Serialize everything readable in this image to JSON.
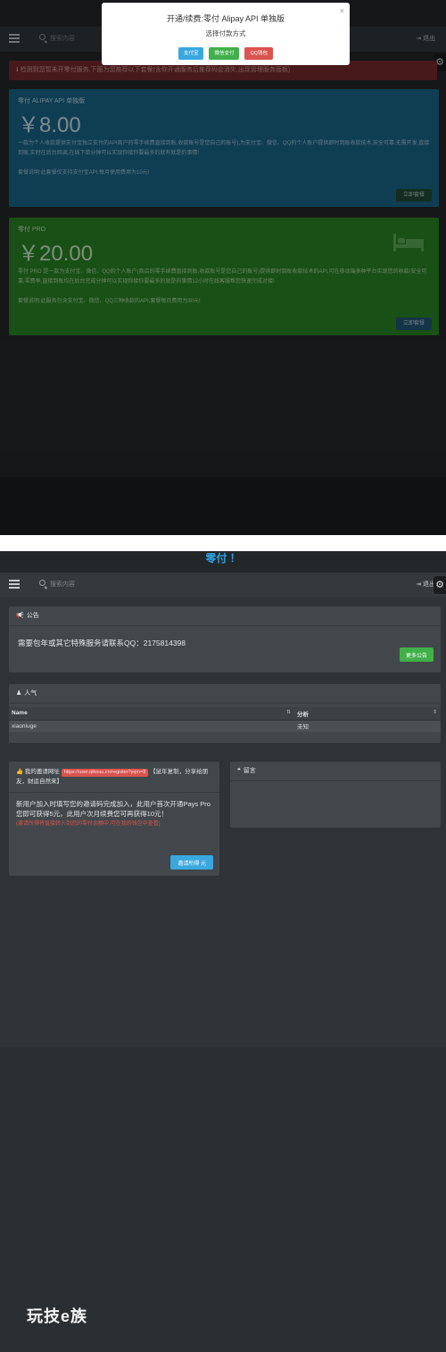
{
  "shot1": {
    "topbar": {
      "search_placeholder": "搜索内容",
      "logout_label": "退出",
      "gear_glyph": "⚙"
    },
    "alert": {
      "text": "ℹ 检测到您暂未开零付服务,下面为您推荐以下套餐(含你开通服务后推荐码会消失,出现管理服务面板)"
    },
    "plans": [
      {
        "title": "零付 ALIPAY API 单独版",
        "price": "￥8.00",
        "desc": "一款为个人收款提供支付宝独立支付的API商户的零手续费直接到账,收款账号是您自己的账号),为支付宝、微信、QQ的个人账户提供即时到账收款技术,安全可靠,无需开发,直接到账,实时在后台回调,在线下单分钟可以实现你接你要最多的就有就是的事情!",
        "note": "套餐说明:此套餐仅支持支付宝API,每月使用费用为10元!",
        "button": "立即套餐",
        "color": "#1b6a8e"
      },
      {
        "title": "零付 PRO",
        "price": "￥20.00",
        "desc": "零付 PRO 是一款为支付宝、微信、QQ的个人账户(商店的零手续费直接到账,收款账号是您自己的账号)提供即时到账收款技术的API,可在移动端多种平台实现您的收款/安全可靠,零费率,直接到账均在后台完成分钟可以实现你接你要最多的就是的事情12小时在线客服帮您快速完成对接!",
        "note": "套餐说明:此服务包含支付宝、微信、QQ三种收款的API,套餐每月费用为30元!",
        "button": "立即套餐",
        "color": "#2a8a26",
        "icon": "bed-icon"
      }
    ],
    "modal": {
      "title": "开通/续费:零付 Alipay API 单独版",
      "subtitle": "选择付款方式",
      "close": "×",
      "buttons": {
        "alipay": "支付宝",
        "wechat": "微信支付",
        "qq": "QQ钱包"
      },
      "colors": {
        "alipay": "#3aa8df",
        "wechat": "#42b04a",
        "qq": "#d9534f"
      }
    }
  },
  "shot2": {
    "brand": "零付 ！",
    "topbar": {
      "search_placeholder": "搜索内容",
      "logout_label": "退出",
      "gear_glyph": "⚙"
    },
    "notice": {
      "icon": "📢",
      "title": "公告",
      "text": "需要包年或其它特殊服务请联系QQ：2175814398",
      "more_button": "更多公告"
    },
    "popular": {
      "icon": "♟",
      "title": "人气",
      "columns": [
        "Name",
        "分析"
      ],
      "rows": [
        {
          "name": "xiaoniuge",
          "value": "未知"
        }
      ]
    },
    "invite": {
      "icon": "👍",
      "prefix": "我的邀请网址",
      "url": "https://user.qikouu.cn/register?yqm=8",
      "suffix": "【鼠年复制，分享给朋友，财运自然来】",
      "body": "新用户加入时填写您的邀请码完成加入，此用户首次开通Pays Pro您即可获得5元，此用户次月续费您可再获得10元！",
      "red_note": "(邀请所得将直接转入到您的零付余额中,可在我的钱包中查看)",
      "button": "邀请所得 元"
    },
    "guestbook": {
      "icon": "❝",
      "title": "留言"
    },
    "watermark": "玩技e族"
  }
}
